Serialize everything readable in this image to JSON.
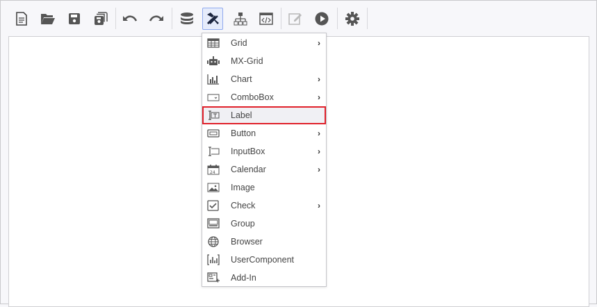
{
  "toolbar": {
    "buttons": [
      "new",
      "open",
      "save",
      "save-all",
      "undo",
      "redo",
      "database",
      "tools",
      "hierarchy",
      "script",
      "edit",
      "run",
      "settings"
    ]
  },
  "menu": {
    "items": [
      {
        "label": "Grid",
        "submenu": true
      },
      {
        "label": "MX-Grid",
        "submenu": false
      },
      {
        "label": "Chart",
        "submenu": true
      },
      {
        "label": "ComboBox",
        "submenu": true
      },
      {
        "label": "Label",
        "submenu": false,
        "highlighted": true
      },
      {
        "label": "Button",
        "submenu": true
      },
      {
        "label": "InputBox",
        "submenu": true
      },
      {
        "label": "Calendar",
        "submenu": true
      },
      {
        "label": "Image",
        "submenu": false
      },
      {
        "label": "Check",
        "submenu": true
      },
      {
        "label": "Group",
        "submenu": false
      },
      {
        "label": "Browser",
        "submenu": false
      },
      {
        "label": "UserComponent",
        "submenu": false
      },
      {
        "label": "Add-In",
        "submenu": false
      }
    ],
    "arrow": "›",
    "highlight_color": "#e0202a"
  }
}
